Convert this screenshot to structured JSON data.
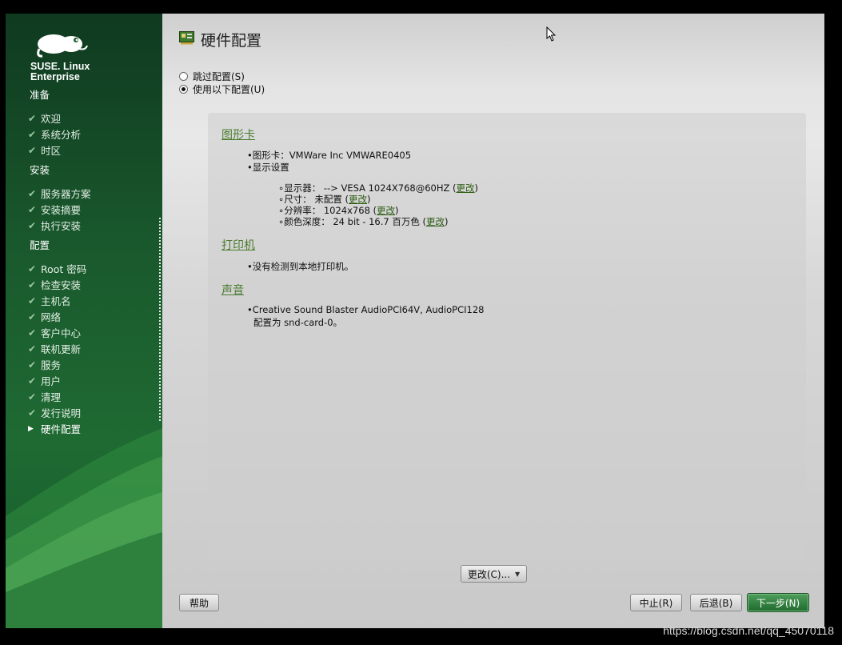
{
  "brand": {
    "line1": "SUSE. Linux",
    "line2": "Enterprise"
  },
  "sidebar": {
    "sections": [
      {
        "label": "准备",
        "steps": [
          {
            "label": "欢迎"
          },
          {
            "label": "系统分析"
          },
          {
            "label": "时区"
          }
        ]
      },
      {
        "label": "安装",
        "steps": [
          {
            "label": "服务器方案"
          },
          {
            "label": "安装摘要"
          },
          {
            "label": "执行安装"
          }
        ]
      },
      {
        "label": "配置",
        "steps": [
          {
            "label": "Root 密码"
          },
          {
            "label": "检查安装"
          },
          {
            "label": "主机名"
          },
          {
            "label": "网络"
          },
          {
            "label": "客户中心"
          },
          {
            "label": "联机更新"
          },
          {
            "label": "服务"
          },
          {
            "label": "用户"
          },
          {
            "label": "清理"
          },
          {
            "label": "发行说明"
          },
          {
            "label": "硬件配置"
          }
        ]
      }
    ],
    "current_step": "硬件配置"
  },
  "page": {
    "title": "硬件配置"
  },
  "options": {
    "skip": "跳过配置(S)",
    "use": "使用以下配置(U)",
    "selected": "use"
  },
  "graphics": {
    "heading": "图形卡",
    "card": "图形卡：VMWare Inc VMWARE0405",
    "display_settings": "显示设置",
    "monitor": "显示器： --> VESA 1024X768@60HZ (",
    "size": "尺寸： 未配置 (",
    "resolution": "分辨率： 1024x768 (",
    "depth": "颜色深度： 24 bit - 16.7 百万色 (",
    "change_link": "更改",
    "close_paren": ")"
  },
  "printer": {
    "heading": "打印机",
    "text": "没有检测到本地打印机。"
  },
  "sound": {
    "heading": "声音",
    "device": "Creative Sound Blaster AudioPCI64V, AudioPCI128",
    "configured": "配置为 snd-card-0。"
  },
  "buttons": {
    "change": "更改(C)...",
    "help": "帮助",
    "abort": "中止(R)",
    "back": "后退(B)",
    "next": "下一步(N)"
  },
  "watermark": "https://blog.csdn.net/qq_45070118",
  "colors": {
    "sidebar_green": "#1a5a2d",
    "link_green": "#4a7c2e",
    "next_button": "#2f8040"
  }
}
